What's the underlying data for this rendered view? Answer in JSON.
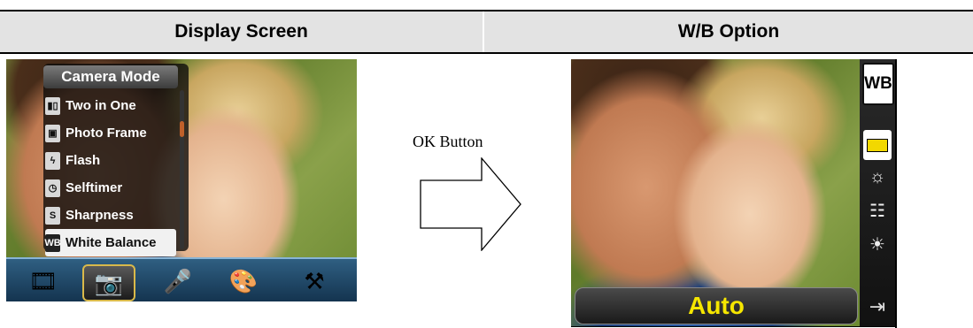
{
  "header": {
    "left_title": "Display Screen",
    "right_title": "W/B Option"
  },
  "left_screen": {
    "menu_title": "Camera Mode",
    "menu_items": [
      {
        "label": "Two in One",
        "icon": "two-in-one-icon",
        "glyph": "▮▯"
      },
      {
        "label": "Photo Frame",
        "icon": "photo-frame-icon",
        "glyph": "▣"
      },
      {
        "label": "Flash",
        "icon": "flash-icon",
        "glyph": "ϟ"
      },
      {
        "label": "Selftimer",
        "icon": "selftimer-icon",
        "glyph": "◷"
      },
      {
        "label": "Sharpness",
        "icon": "sharpness-icon",
        "glyph": "S"
      },
      {
        "label": "White Balance",
        "icon": "white-balance-icon",
        "glyph": "WB",
        "selected": true
      }
    ],
    "mode_tabs": [
      {
        "name": "movie-mode-icon",
        "glyph": "🎞"
      },
      {
        "name": "camera-mode-icon",
        "glyph": "📷",
        "active": true
      },
      {
        "name": "voice-mode-icon",
        "glyph": "🎤"
      },
      {
        "name": "effect-mode-icon",
        "glyph": "🎨"
      },
      {
        "name": "setup-mode-icon",
        "glyph": "⚒"
      }
    ]
  },
  "middle": {
    "label": "OK Button"
  },
  "right_screen": {
    "badge": "WB",
    "options": [
      {
        "name": "auto-wb-icon",
        "glyph": "",
        "selected": true
      },
      {
        "name": "daylight-icon",
        "glyph": "☼"
      },
      {
        "name": "fluorescent-icon",
        "glyph": "☷"
      },
      {
        "name": "tungsten-icon",
        "glyph": "☀"
      }
    ],
    "exit_glyph": "⇥",
    "current_value": "Auto"
  }
}
